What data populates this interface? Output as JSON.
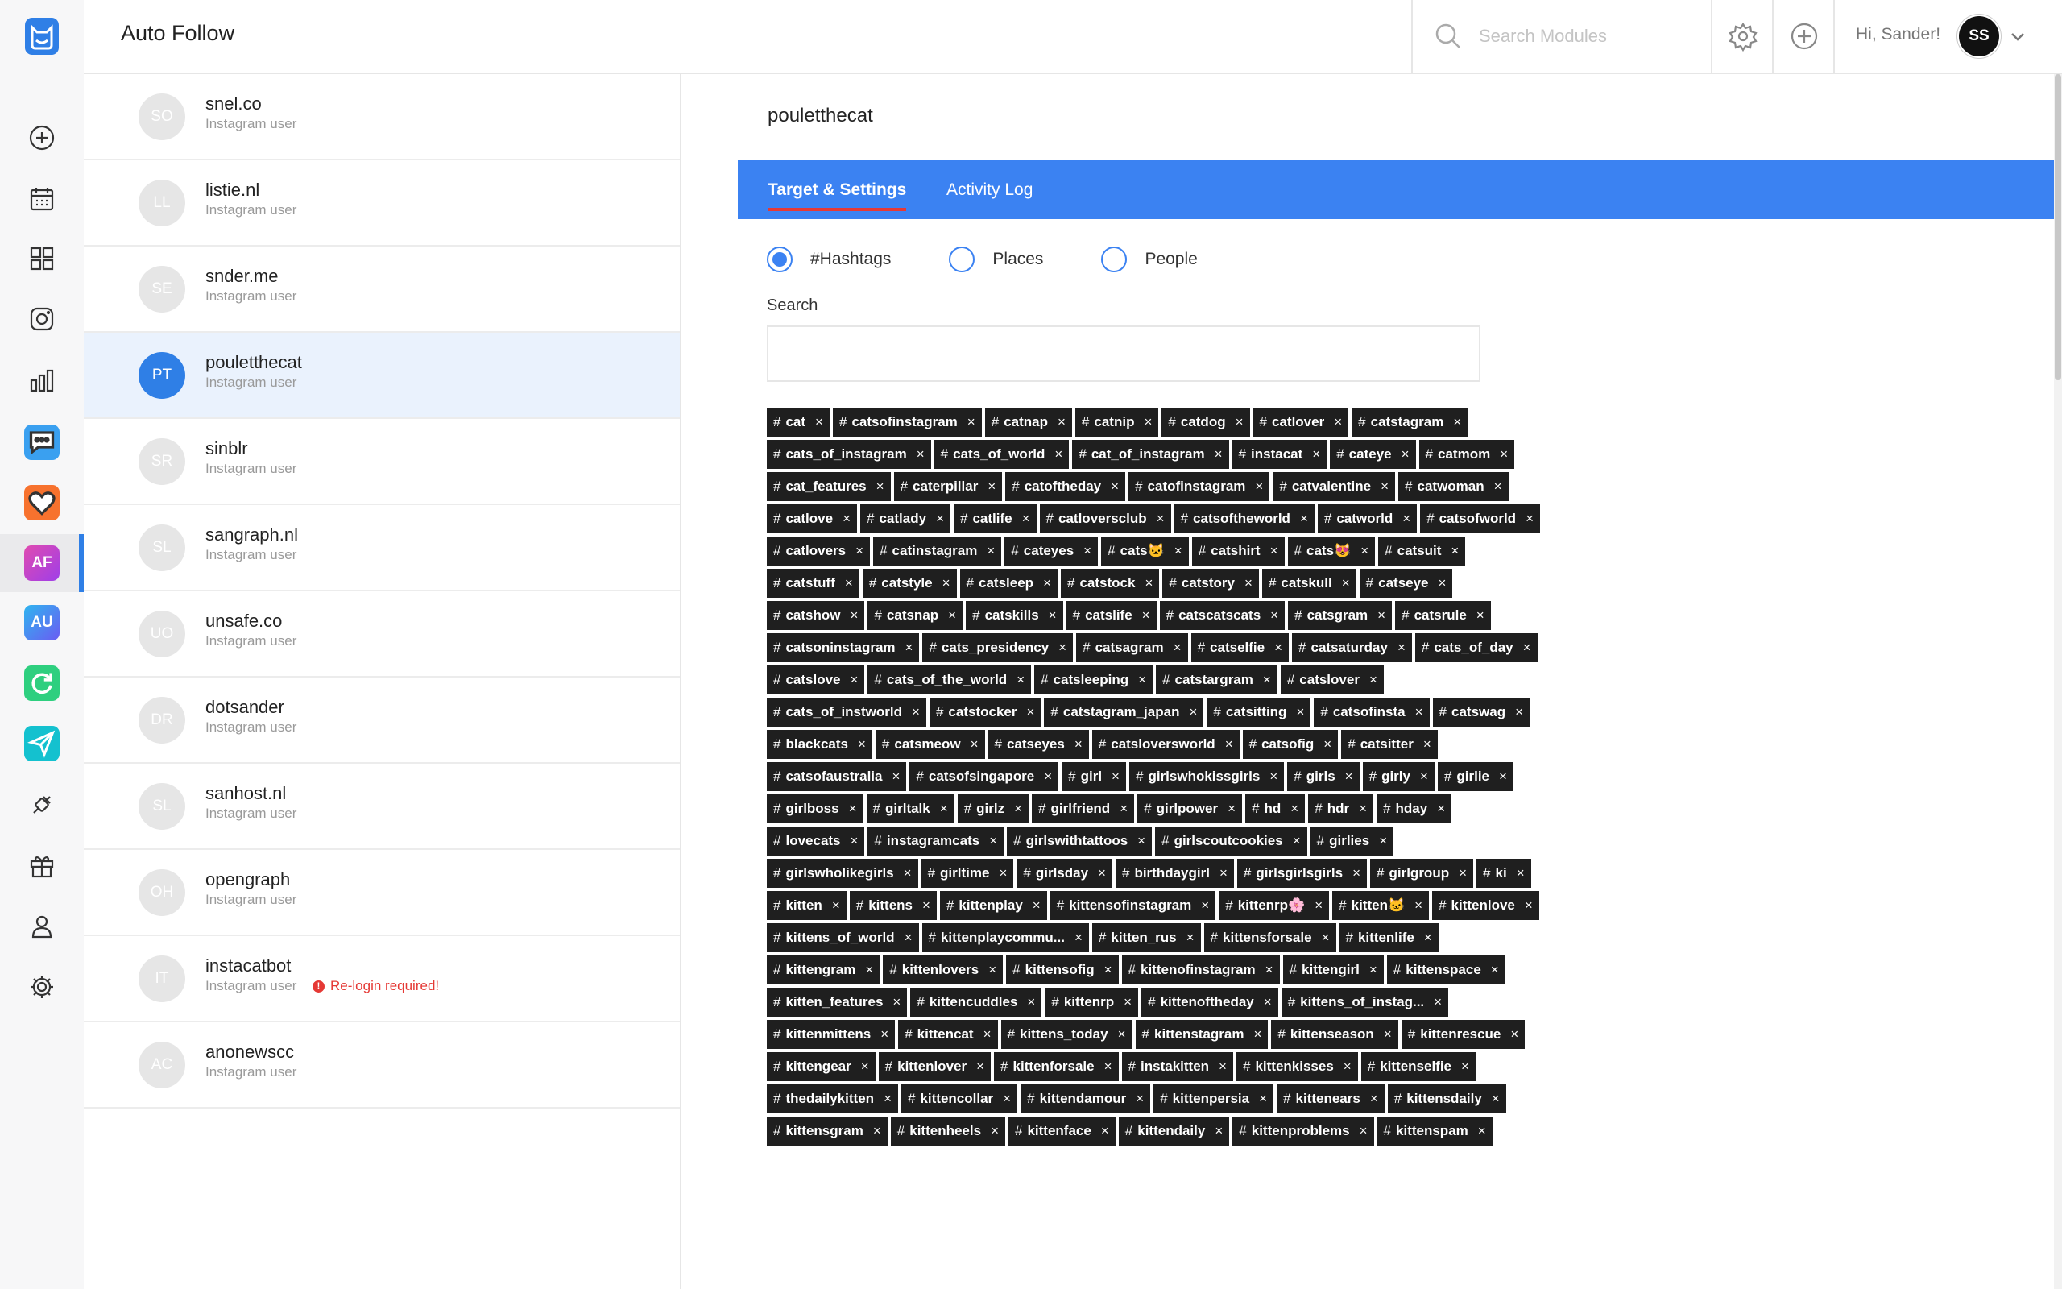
{
  "app": {
    "title": "Auto Follow",
    "search_placeholder": "Search Modules",
    "greeting": "Hi, Sander!",
    "user_initials": "SS"
  },
  "rail": {
    "modules": [
      {
        "label": "",
        "color": "#3aa0f0",
        "icon": "chat-bubble-icon"
      },
      {
        "label": "",
        "color": "#f7722e",
        "icon": "heart-icon"
      },
      {
        "label": "AF",
        "color": "#c63fd6",
        "icon": ""
      },
      {
        "label": "AU",
        "color": "#4d7ef4",
        "icon": ""
      },
      {
        "label": "",
        "color": "#2ecf7f",
        "icon": "refresh-icon"
      },
      {
        "label": "",
        "color": "#14c1cf",
        "icon": "paper-plane-icon"
      }
    ]
  },
  "accounts": [
    {
      "initials": "SO",
      "name": "snel.co",
      "sub": "Instagram user"
    },
    {
      "initials": "LL",
      "name": "listie.nl",
      "sub": "Instagram user"
    },
    {
      "initials": "SE",
      "name": "snder.me",
      "sub": "Instagram user"
    },
    {
      "initials": "PT",
      "name": "pouletthecat",
      "sub": "Instagram user",
      "selected": true
    },
    {
      "initials": "SR",
      "name": "sinblr",
      "sub": "Instagram user"
    },
    {
      "initials": "SL",
      "name": "sangraph.nl",
      "sub": "Instagram user"
    },
    {
      "initials": "UO",
      "name": "unsafe.co",
      "sub": "Instagram user"
    },
    {
      "initials": "DR",
      "name": "dotsander",
      "sub": "Instagram user"
    },
    {
      "initials": "SL",
      "name": "sanhost.nl",
      "sub": "Instagram user"
    },
    {
      "initials": "OH",
      "name": "opengraph",
      "sub": "Instagram user"
    },
    {
      "initials": "IT",
      "name": "instacatbot",
      "sub": "Instagram user",
      "warning": "Re-login required!"
    },
    {
      "initials": "AC",
      "name": "anonewscc",
      "sub": "Instagram user"
    }
  ],
  "panel": {
    "title": "pouletthecat",
    "tabs": [
      {
        "label": "Target & Settings",
        "active": true
      },
      {
        "label": "Activity Log",
        "active": false
      }
    ],
    "radios": [
      {
        "label": "#Hashtags",
        "checked": true
      },
      {
        "label": "Places",
        "checked": false
      },
      {
        "label": "People",
        "checked": false
      }
    ],
    "search_label": "Search",
    "search_value": "",
    "tags": [
      "cat",
      "catsofinstagram",
      "catnap",
      "catnip",
      "catdog",
      "catlover",
      "catstagram",
      "cats_of_instagram",
      "cats_of_world",
      "cat_of_instagram",
      "instacat",
      "cateye",
      "catmom",
      "cat_features",
      "caterpillar",
      "catoftheday",
      "catofinstagram",
      "catvalentine",
      "catwoman",
      "catlove",
      "catlady",
      "catlife",
      "catloversclub",
      "catsoftheworld",
      "catworld",
      "catsofworld",
      "catlovers",
      "catinstagram",
      "cateyes",
      "cats🐱",
      "catshirt",
      "cats😻",
      "catsuit",
      "catstuff",
      "catstyle",
      "catsleep",
      "catstock",
      "catstory",
      "catskull",
      "catseye",
      "catshow",
      "catsnap",
      "catskills",
      "catslife",
      "catscatscats",
      "catsgram",
      "catsrule",
      "catsoninstagram",
      "cats_presidency",
      "catsagram",
      "catselfie",
      "catsaturday",
      "cats_of_day",
      "catslove",
      "cats_of_the_world",
      "catsleeping",
      "catstargram",
      "catslover",
      "cats_of_instworld",
      "catstocker",
      "catstagram_japan",
      "catsitting",
      "catsofinsta",
      "catswag",
      "blackcats",
      "catsmeow",
      "catseyes",
      "catsloversworld",
      "catsofig",
      "catsitter",
      "catsofaustralia",
      "catsofsingapore",
      "girl",
      "girlswhokissgirls",
      "girls",
      "girly",
      "girlie",
      "girlboss",
      "girltalk",
      "girlz",
      "girlfriend",
      "girlpower",
      "hd",
      "hdr",
      "hday",
      "lovecats",
      "instagramcats",
      "girlswithtattoos",
      "girlscoutcookies",
      "girlies",
      "girlswholikegirls",
      "girltime",
      "girlsday",
      "birthdaygirl",
      "girlsgirlsgirls",
      "girlgroup",
      "ki",
      "kitten",
      "kittens",
      "kittenplay",
      "kittensofinstagram",
      "kittenrp🌸",
      "kitten🐱",
      "kittenlove",
      "kittens_of_world",
      "kittenplaycommu...",
      "kitten_rus",
      "kittensforsale",
      "kittenlife",
      "kittengram",
      "kittenlovers",
      "kittensofig",
      "kittenofinstagram",
      "kittengirl",
      "kittenspace",
      "kitten_features",
      "kittencuddles",
      "kittenrp",
      "kittenoftheday",
      "kittens_of_instag...",
      "kittenmittens",
      "kittencat",
      "kittens_today",
      "kittenstagram",
      "kittenseason",
      "kittenrescue",
      "kittengear",
      "kittenlover",
      "kittenforsale",
      "instakitten",
      "kittenkisses",
      "kittenselfie",
      "thedailykitten",
      "kittencollar",
      "kittendamour",
      "kittenpersia",
      "kittenears",
      "kittensdaily",
      "kittensgram",
      "kittenheels",
      "kittenface",
      "kittendaily",
      "kittenproblems",
      "kittenspam"
    ]
  }
}
